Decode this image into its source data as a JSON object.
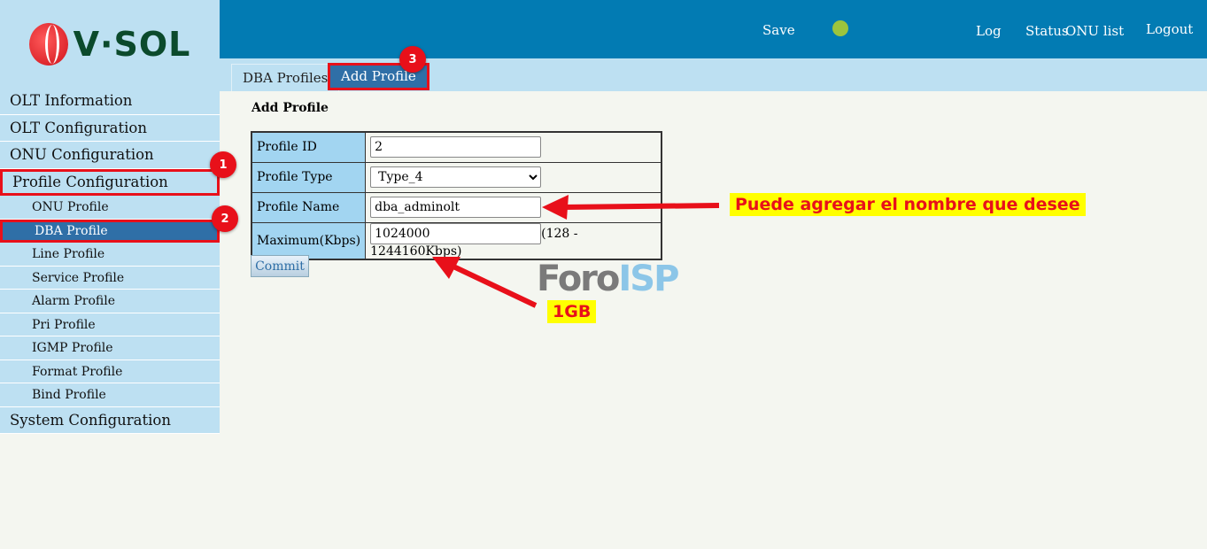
{
  "logo": {
    "text": "V·SOL"
  },
  "header": {
    "save": "Save",
    "log": "Log",
    "status": "Status",
    "onu_list": "ONU list",
    "logout": "Logout",
    "status_color": "#9cc43e"
  },
  "tabs": [
    {
      "label": "DBA Profiles"
    },
    {
      "label": "Add Profile"
    }
  ],
  "sidebar": {
    "items": [
      {
        "label": "OLT Information"
      },
      {
        "label": "OLT Configuration"
      },
      {
        "label": "ONU Configuration"
      },
      {
        "label": "Profile Configuration"
      },
      {
        "label": "ONU Profile"
      },
      {
        "label": "DBA Profile"
      },
      {
        "label": "Line Profile"
      },
      {
        "label": "Service Profile"
      },
      {
        "label": "Alarm Profile"
      },
      {
        "label": "Pri Profile"
      },
      {
        "label": "IGMP Profile"
      },
      {
        "label": "Format Profile"
      },
      {
        "label": "Bind Profile"
      },
      {
        "label": "System Configuration"
      }
    ]
  },
  "form": {
    "title": "Add Profile",
    "profile_id_label": "Profile ID",
    "profile_id": "2",
    "profile_type_label": "Profile Type",
    "profile_type": "Type_4",
    "profile_name_label": "Profile Name",
    "profile_name": "dba_adminolt",
    "maximum_label": "Maximum(Kbps)",
    "maximum": "1024000",
    "maximum_range": "(128 - 1244160Kbps)",
    "commit": "Commit"
  },
  "annotations": {
    "badge1": "1",
    "badge2": "2",
    "badge3": "3",
    "note_name": "Puede agregar el nombre que desee",
    "note_1gb": "1GB",
    "watermark_a": "Foro",
    "watermark_b": "ISP"
  }
}
